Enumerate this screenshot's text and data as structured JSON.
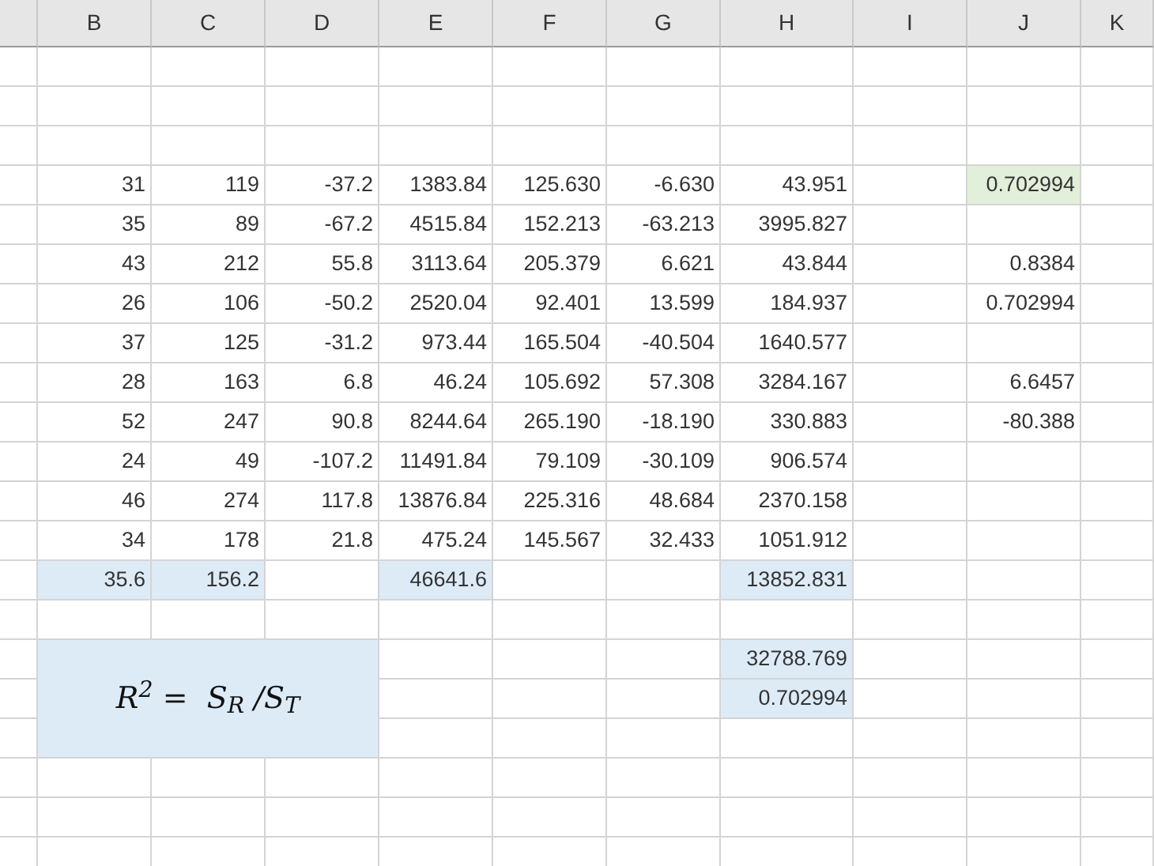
{
  "columns": [
    "B",
    "C",
    "D",
    "E",
    "F",
    "G",
    "H",
    "I",
    "J",
    "K"
  ],
  "rows": [
    {},
    {},
    {},
    {
      "B": {
        "text": "31"
      },
      "C": {
        "text": "119"
      },
      "D": {
        "text": "-37.2"
      },
      "E": {
        "text": "1383.84"
      },
      "F": {
        "text": "125.630"
      },
      "G": {
        "text": "-6.630"
      },
      "H": {
        "text": "43.951"
      },
      "J": {
        "text": "0.702994",
        "color": "#e2efda"
      }
    },
    {
      "B": {
        "text": "35"
      },
      "C": {
        "text": "89"
      },
      "D": {
        "text": "-67.2"
      },
      "E": {
        "text": "4515.84"
      },
      "F": {
        "text": "152.213"
      },
      "G": {
        "text": "-63.213"
      },
      "H": {
        "text": "3995.827"
      }
    },
    {
      "B": {
        "text": "43"
      },
      "C": {
        "text": "212"
      },
      "D": {
        "text": "55.8"
      },
      "E": {
        "text": "3113.64"
      },
      "F": {
        "text": "205.379"
      },
      "G": {
        "text": "6.621"
      },
      "H": {
        "text": "43.844"
      },
      "J": {
        "text": "0.8384"
      }
    },
    {
      "B": {
        "text": "26"
      },
      "C": {
        "text": "106"
      },
      "D": {
        "text": "-50.2"
      },
      "E": {
        "text": "2520.04"
      },
      "F": {
        "text": "92.401"
      },
      "G": {
        "text": "13.599"
      },
      "H": {
        "text": "184.937"
      },
      "J": {
        "text": "0.702994"
      }
    },
    {
      "B": {
        "text": "37"
      },
      "C": {
        "text": "125"
      },
      "D": {
        "text": "-31.2"
      },
      "E": {
        "text": "973.44"
      },
      "F": {
        "text": "165.504"
      },
      "G": {
        "text": "-40.504"
      },
      "H": {
        "text": "1640.577"
      }
    },
    {
      "B": {
        "text": "28"
      },
      "C": {
        "text": "163"
      },
      "D": {
        "text": "6.8"
      },
      "E": {
        "text": "46.24"
      },
      "F": {
        "text": "105.692"
      },
      "G": {
        "text": "57.308"
      },
      "H": {
        "text": "3284.167"
      },
      "J": {
        "text": "6.6457"
      }
    },
    {
      "B": {
        "text": "52"
      },
      "C": {
        "text": "247"
      },
      "D": {
        "text": "90.8"
      },
      "E": {
        "text": "8244.64"
      },
      "F": {
        "text": "265.190"
      },
      "G": {
        "text": "-18.190"
      },
      "H": {
        "text": "330.883"
      },
      "J": {
        "text": "-80.388"
      }
    },
    {
      "B": {
        "text": "24"
      },
      "C": {
        "text": "49"
      },
      "D": {
        "text": "-107.2"
      },
      "E": {
        "text": "11491.84"
      },
      "F": {
        "text": "79.109"
      },
      "G": {
        "text": "-30.109"
      },
      "H": {
        "text": "906.574"
      }
    },
    {
      "B": {
        "text": "46"
      },
      "C": {
        "text": "274"
      },
      "D": {
        "text": "117.8"
      },
      "E": {
        "text": "13876.84"
      },
      "F": {
        "text": "225.316"
      },
      "G": {
        "text": "48.684"
      },
      "H": {
        "text": "2370.158"
      }
    },
    {
      "B": {
        "text": "34"
      },
      "C": {
        "text": "178"
      },
      "D": {
        "text": "21.8"
      },
      "E": {
        "text": "475.24"
      },
      "F": {
        "text": "145.567"
      },
      "G": {
        "text": "32.433"
      },
      "H": {
        "text": "1051.912"
      }
    },
    {
      "B": {
        "text": "35.6",
        "color": "#ddebf7"
      },
      "C": {
        "text": "156.2",
        "color": "#ddebf7"
      },
      "E": {
        "text": "46641.6",
        "color": "#ddebf7"
      },
      "H": {
        "text": "13852.831",
        "color": "#ddebf7"
      }
    },
    {},
    {
      "formula": {
        "text": "R$^{2}$ =  S$_{R}$ /S$_{T}$",
        "color": "#ddebf7"
      },
      "H": {
        "text": "32788.769",
        "color": "#ddebf7"
      }
    },
    {
      "H": {
        "text": "0.702994",
        "color": "#ddebf7"
      }
    },
    {},
    {},
    {},
    {}
  ]
}
